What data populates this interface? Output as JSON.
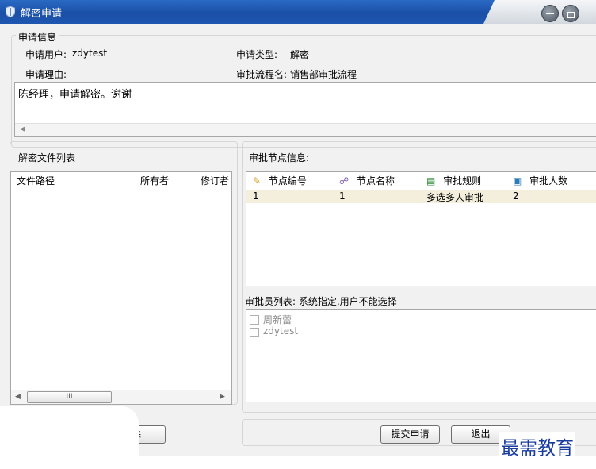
{
  "window": {
    "title": "解密申请"
  },
  "application_info": {
    "section_label": "申请信息",
    "user_label": "申请用户:",
    "user_value": "zdytest",
    "type_label": "申请类型:",
    "type_value": "解密",
    "reason_label": "申请理由:",
    "flow_label": "审批流程名:",
    "flow_value": "销售部审批流程",
    "reason_text": "陈经理，申请解密。谢谢"
  },
  "file_list": {
    "section_label": "解密文件列表",
    "columns": [
      "文件路径",
      "所有者",
      "修订者"
    ],
    "scroll_glyph": "III"
  },
  "approval_nodes": {
    "section_label": "审批节点信息:",
    "columns": [
      "节点编号",
      "节点名称",
      "审批规则",
      "审批人数"
    ],
    "rows": [
      [
        "1",
        "1",
        "多选多人审批",
        "2"
      ]
    ]
  },
  "approvers": {
    "label": "审批员列表: 系统指定,用户不能选择",
    "items": [
      "周新蕾",
      "zdytest"
    ]
  },
  "buttons": {
    "delete": "除",
    "submit": "提交申请",
    "exit": "退出"
  },
  "watermark": "最需教育",
  "colors": {
    "title_bar": "#1a4fa6",
    "selected_row": "#f3efdc",
    "watermark": "#1a3c9e"
  }
}
